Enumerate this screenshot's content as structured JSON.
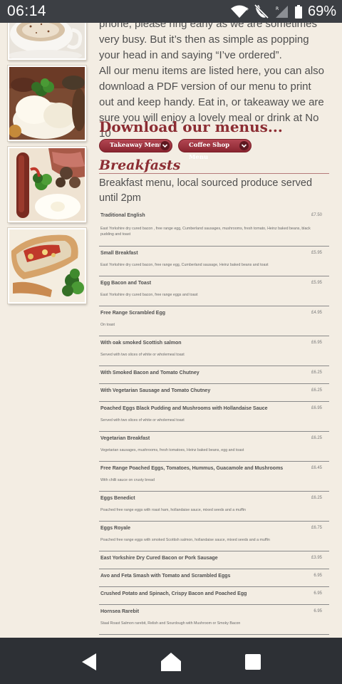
{
  "status_bar": {
    "time": "06:14",
    "battery": "69%"
  },
  "intro": {
    "paragraph_a": "phone, please ring early as we are sometimes very busy. But it’s then as simple as popping your head in and saying “I’ve ordered”.",
    "paragraph_b": "All our menu items are listed here, you can also download a PDF version of our menu to print out and keep handy. Eat in, or takeaway we are sure you will enjoy a lovely meal or drink at No 10"
  },
  "downloads": {
    "heading": "Download our menus...",
    "takeaway_label": "Takeaway Menu",
    "coffee_label": "Coffee Shop Menu"
  },
  "breakfasts": {
    "heading": "Breakfasts",
    "subtitle": "Breakfast menu, local sourced produce served until 2pm",
    "items": [
      {
        "name": "Traditional English",
        "price": "£7.50",
        "desc": "East Yorkshire dry cured bacon , free range egg, Cumberland sausages, mushrooms, fresh tomato, Heinz baked beans, black pudding and toast"
      },
      {
        "name": "Small Breakfast",
        "price": "£5.95",
        "desc": "East Yorkshire dry cured bacon, free range egg, Cumberland sausage, Heinz baked beans and toast"
      },
      {
        "name": "Egg Bacon and Toast",
        "price": "£5.95",
        "desc": "East Yorkshire dry cured bacon, free range eggs and toast"
      },
      {
        "name": "Free Range Scrambled Egg",
        "price": "£4.95",
        "desc": "On toast"
      },
      {
        "name": "With oak smoked Scottish salmon",
        "price": "£6.95",
        "desc": "Served with two slices of white or wholemeal toast"
      },
      {
        "name": "With Smoked Bacon and Tomato Chutney",
        "price": "£6.25",
        "desc": ""
      },
      {
        "name": "With Vegetarian Sausage and Tomato Chutney",
        "price": "£6.25",
        "desc": ""
      },
      {
        "name": "Poached Eggs Black Pudding and Mushrooms with Hollandaise Sauce",
        "price": "£6.95",
        "desc": "Served with two slices of white or wholemeal toast"
      },
      {
        "name": "Vegetarian Breakfast",
        "price": "£6.25",
        "desc": "Vegetarian sausages, mushrooms, fresh tomatoes, Heinz baked beans, egg and toast"
      },
      {
        "name": "Free Range Poached Eggs, Tomatoes, Hummus, Guacamole and Mushrooms",
        "price": "£6.45",
        "desc": "With chilli sauce on crusty bread"
      },
      {
        "name": "Eggs Benedict",
        "price": "£6.25",
        "desc": "Poached free range eggs with roast ham, hollandaise sauce, mixed seeds and a muffin"
      },
      {
        "name": "Eggs Royale",
        "price": "£6.75",
        "desc": "Poached free range eggs with smoked Scottish salmon, hollandaise sauce, mixed seeds and a muffin"
      },
      {
        "name": "East Yorkshire Dry Cured Bacon or Pork Sausage",
        "price": "£3.95",
        "desc": ""
      },
      {
        "name": "Avo and Feta Smash with Tomato and Scrambled Eggs",
        "price": "6.95",
        "desc": ""
      },
      {
        "name": "Crushed Potato and Spinach, Crispy Bacon and Poached Egg",
        "price": "6.95",
        "desc": ""
      },
      {
        "name": "Hornsea Rarebit",
        "price": "6.95",
        "desc": "Staal Roast Salmon rarebit, Relish and Sourdough with Mushroom or Smoky Bacon"
      }
    ]
  },
  "icons": {
    "wifi": "wifi-icon",
    "mute": "mute-icon",
    "signal": "signal-icon",
    "battery": "battery-icon",
    "back": "back-icon",
    "home": "home-icon",
    "recents": "recents-icon"
  },
  "colors": {
    "accent": "#8c2d33",
    "page_bg": "#f3ede3",
    "nav_bg": "#2d3035"
  }
}
